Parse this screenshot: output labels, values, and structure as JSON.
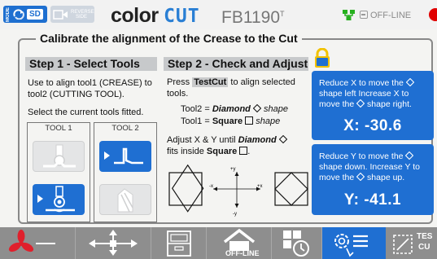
{
  "header": {
    "mode_tag": "MODE",
    "sd_label": "SD",
    "reverse_label": "REVERSE SIDE",
    "brand_prefix": "color",
    "brand_cut": "CUT",
    "model": "FB1190",
    "model_sup": "T",
    "status_label": "OFF-LINE",
    "status_color": "#e00000",
    "icons": [
      "mode-swap-icon",
      "reverse-side-icon",
      "network-icon",
      "offline-box-icon",
      "status-dot-icon"
    ]
  },
  "title": "Calibrate the alignment of the Crease to the Cut",
  "step1": {
    "heading": "Step 1 - Select Tools",
    "text": "Use to align tool1 (CREASE) to tool2 (CUTTING TOOL).",
    "text2": "Select the current tools fitted.",
    "tool1_label": "TOOL 1",
    "tool2_label": "TOOL 2",
    "tool1_options": [
      "crease-wheel-icon (disabled)",
      "creasing-wheel-icon (selected)"
    ],
    "tool2_options": [
      "tangential-blade-icon (selected)",
      "drag-knife-icon (disabled)"
    ]
  },
  "step2": {
    "heading": "Step 2 - Check and Adjust",
    "press": "Press",
    "testcut": "TestCut",
    "press_rest": "to align selected",
    "tools_word": "tools.",
    "tool2_pre": "Tool2 =",
    "tool2_shape": "Diamond",
    "tool2_post": "shape",
    "tool1_pre": "Tool1 =",
    "tool1_shape": "Square",
    "tool1_post": "shape",
    "adjust_pre": "Adjust  X & Y until",
    "adjust_shape": "Diamond",
    "fits_pre": "fits inside",
    "fits_shape": "Square",
    "axis_plus_y": "+y",
    "axis_minus_y": "-y",
    "axis_minus_x": "-x",
    "axis_plus_x": "+x"
  },
  "adjust_x": {
    "line1": "Reduce X to move the",
    "line2": "shape left  Increase X to",
    "line3a": "move the",
    "line3b": "shape right.",
    "value": "X: -30.6"
  },
  "adjust_y": {
    "line1": "Reduce Y to move the",
    "line2": "shape down.  Increase Y to",
    "line3a": "move the",
    "line3b": "shape up.",
    "value": "Y: -41.1"
  },
  "bottom_bar": {
    "buttons": [
      "fan-vacuum-button",
      "move-head-button",
      "file-storage-button",
      "offline-home-button",
      "job-timer-button",
      "settings-menu-button",
      "test-cut-button"
    ],
    "offline_label": "OFF-LINE",
    "test_label_1": "TES",
    "test_label_2": "CU",
    "active_index": 5
  },
  "colors": {
    "accent_blue": "#1f6fd2",
    "brand_cut_blue": "#2a7fd4",
    "header_bg": "#f2f2f2",
    "bottom_bar_gray": "#8e8e8e",
    "fan_red": "#e0202c",
    "network_green": "#26b01e",
    "lock_yellow": "#f2c200"
  }
}
